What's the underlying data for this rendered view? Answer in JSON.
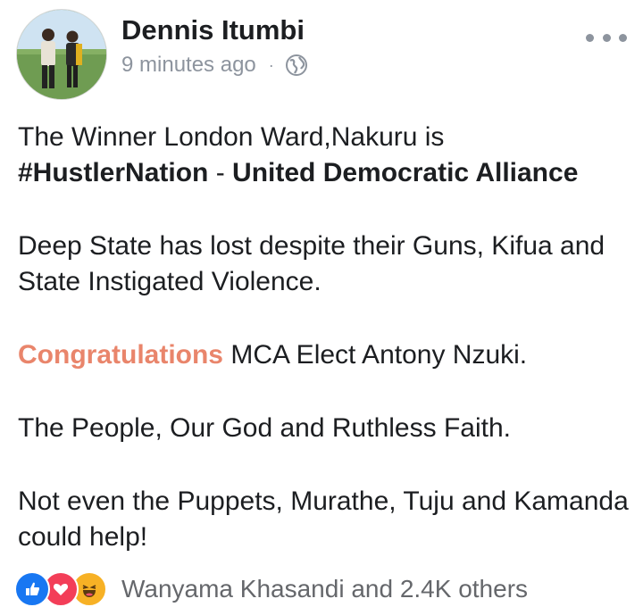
{
  "post": {
    "author": "Dennis Itumbi",
    "time": "9 minutes ago",
    "separator": "·",
    "privacy_icon": "globe-icon",
    "more_icon": "more-horizontal-icon"
  },
  "body": {
    "line1": "The Winner London Ward,Nakuru is",
    "hashtag": "#HustlerNation",
    "dash": " - ",
    "party": "United Democratic Alliance",
    "para2": "Deep State has lost despite their Guns, Kifua and State Instigated Violence.",
    "congrats": "Congratulations",
    "congrats_rest": " MCA Elect Antony Nzuki.",
    "para4": "The People, Our God and Ruthless Faith.",
    "para5": "Not even the Puppets, Murathe, Tuju and Kamanda could help!"
  },
  "reactions": {
    "icons": [
      "like-icon",
      "love-icon",
      "haha-icon"
    ],
    "summary": "Wanyama Khasandi and 2.4K others"
  },
  "colors": {
    "accent": "#e9856b",
    "meta": "#8d949e",
    "like": "#1877f2",
    "love": "#f33e58",
    "haha": "#f7b125"
  }
}
